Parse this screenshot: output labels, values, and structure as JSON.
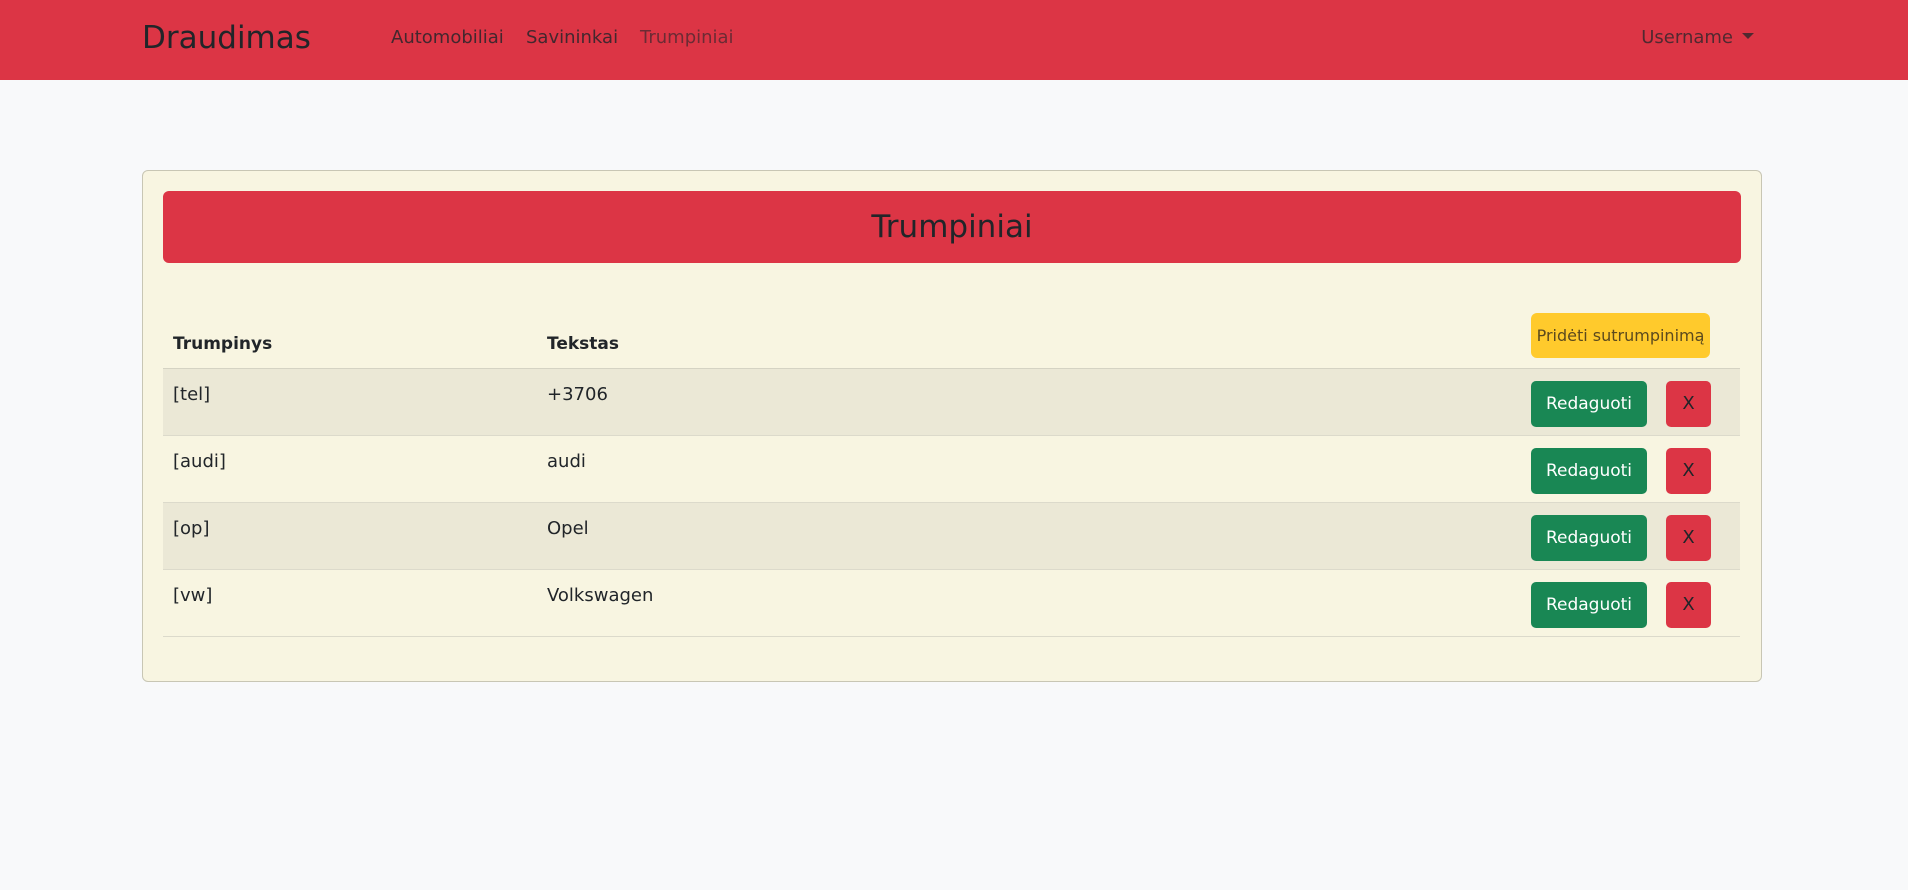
{
  "navbar": {
    "brand": "Draudimas",
    "links": [
      {
        "label": "Automobiliai",
        "active": false
      },
      {
        "label": "Savininkai",
        "active": false
      },
      {
        "label": "Trumpiniai",
        "active": true
      }
    ],
    "user_menu": "Username",
    "background_color": "#dc3545"
  },
  "card": {
    "title": "Trumpiniai",
    "columns": [
      "Trumpinys",
      "Tekstas"
    ],
    "add_button": "Pridėti sutrumpinimą",
    "rows": [
      {
        "short": "[tel]",
        "text": "+3706",
        "edit": "Redaguoti",
        "delete": "X"
      },
      {
        "short": "[audi]",
        "text": "audi",
        "edit": "Redaguoti",
        "delete": "X"
      },
      {
        "short": "[op]",
        "text": "Opel",
        "edit": "Redaguoti",
        "delete": "X"
      },
      {
        "short": "[vw]",
        "text": "Volkswagen",
        "edit": "Redaguoti",
        "delete": "X"
      }
    ]
  },
  "colors": {
    "danger": "#dc3545",
    "success": "#198754",
    "warning": "#ffca2c",
    "card_background": "#f8f5e1",
    "page_background": "#f8f9fa"
  }
}
